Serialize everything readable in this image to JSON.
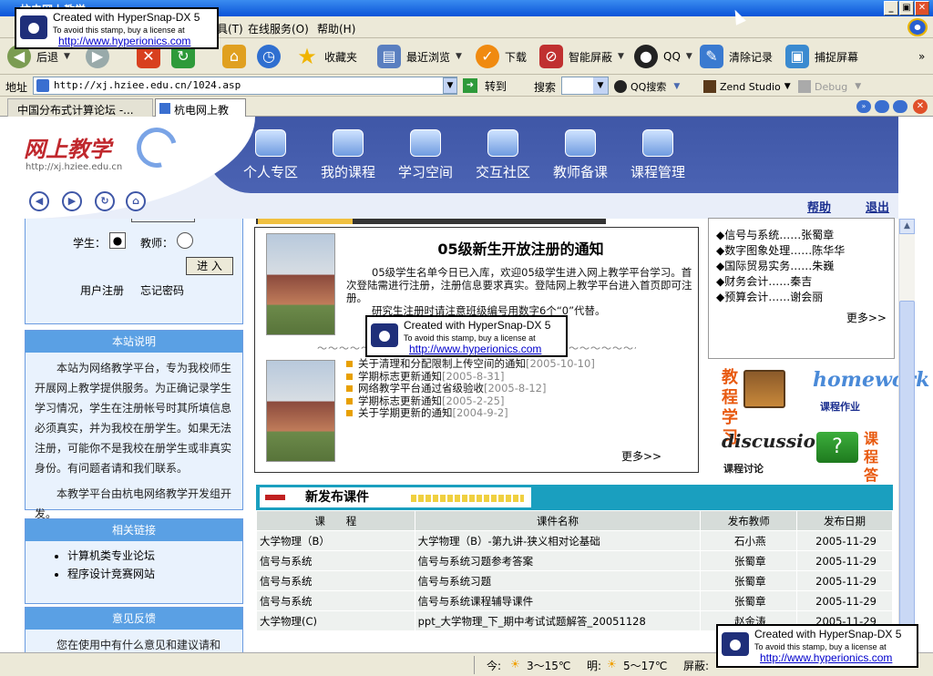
{
  "window": {
    "title": "杭电网上教学",
    "buttons": [
      "_",
      "▣",
      "✕"
    ]
  },
  "menubar": {
    "items": [
      "具(T)",
      "在线服务(O)",
      "帮助(H)"
    ]
  },
  "toolbar": {
    "back_label": "后退",
    "favorites_label": "收藏夹",
    "recent_label": "最近浏览",
    "download_label": "下载",
    "block_label": "智能屏蔽",
    "qq_label": "QQ",
    "clear_label": "清除记录",
    "capture_label": "捕捉屏幕"
  },
  "addressbar": {
    "label": "地址",
    "url": "http://xj.hziee.edu.cn/1024.asp",
    "go_label": "转到",
    "search_label": "搜索",
    "qq_search_label": "QQ搜索",
    "zend_label": "Zend Studio",
    "debug_label": "Debug"
  },
  "tabs": [
    {
      "label": "中国分布式计算论坛 -..."
    },
    {
      "label": "杭电网上教学"
    }
  ],
  "site": {
    "logo_text": "网上教学",
    "logo_url": "http://xj.hziee.edu.cn",
    "nav": [
      "个人专区",
      "我的课程",
      "学习空间",
      "交互社区",
      "教师备课",
      "课程管理"
    ],
    "help_link": "帮助",
    "exit_link": "退出"
  },
  "login": {
    "student_label": "学生：",
    "teacher_label": "教师：",
    "enter_button": "进 入",
    "register_link": "用户注册",
    "forgot_link": "忘记密码"
  },
  "about": {
    "title": "本站说明",
    "para1": "本站为网络教学平台，专为我校师生开展网上教学提供服务。为正确记录学生学习情况，学生在注册帐号时其所填信息必须真实，并为我校在册学生。如果无法注册，可能你不是我校在册学生或非真实身份。有问题者请和我们联系。",
    "para2": "本教学平台由杭电网络教学开发组开发。"
  },
  "links": {
    "title": "相关链接",
    "items": [
      "计算机类专业论坛",
      "程序设计竞赛网站"
    ]
  },
  "feedback": {
    "title": "意见反馈",
    "text": "您在使用中有什么意见和建议请和"
  },
  "notice": {
    "title": "05级新生开放注册的通知",
    "body1": "05级学生名单今日已入库，欢迎05级学生进入网上教学平台学习。首次登陆需进行注册，注册信息要求真实。登陆网上教学平台进入首页即可注册。",
    "body2": "研究生注册时请注意班级编号用数字6个“0”代替。",
    "body3": "网络教学平台的问题，我们会尽快解决。",
    "items": [
      {
        "text": "关于清理和分配限制上传空间的通知",
        "date": "[2005-10-10]"
      },
      {
        "text": "学期标志更新通知",
        "date": "[2005-8-31]"
      },
      {
        "text": "网络教学平台通过省级验收",
        "date": "[2005-8-12]"
      },
      {
        "text": "学期标志更新通知",
        "date": "[2005-2-25]"
      },
      {
        "text": "关于学期更新的通知",
        "date": "[2004-9-2]"
      }
    ],
    "more": "更多>>"
  },
  "teachers": {
    "items": [
      "◆信号与系统……张蜀章",
      "◆数字图象处理……陈华华",
      "◆国际贸易实务……朱巍",
      "◆财务会计……秦吉",
      "◆预算会计……谢会丽"
    ],
    "more": "更多>>"
  },
  "decor": {
    "jiaoxue": "教程学习",
    "homework": "homework",
    "homework_sub": "课程作业",
    "discussion": "discussion",
    "discussion_sub": "课程讨论",
    "dayi": "课程答疑"
  },
  "courseware": {
    "title": "新发布课件",
    "headers": [
      "课　　程",
      "课件名称",
      "发布教师",
      "发布日期"
    ],
    "rows": [
      [
        "大学物理（B）",
        "大学物理（B）-第九讲-狭义相对论基础",
        "石小燕",
        "2005-11-29"
      ],
      [
        "信号与系统",
        "信号与系统习题参考答案",
        "张蜀章",
        "2005-11-29"
      ],
      [
        "信号与系统",
        "信号与系统习题",
        "张蜀章",
        "2005-11-29"
      ],
      [
        "信号与系统",
        "信号与系统课程辅导课件",
        "张蜀章",
        "2005-11-29"
      ],
      [
        "大学物理(C)",
        "ppt_大学物理_下_期中考试试题解答_20051128",
        "赵金涛",
        "2005-11-29"
      ]
    ]
  },
  "statusbar": {
    "today": "今:",
    "today_temp": "3～15℃",
    "tomorrow": "明:",
    "tomorrow_temp": "5～17℃",
    "block": "屏蔽:"
  },
  "stamp": {
    "line1": "Created with HyperSnap-DX 5",
    "line2": "To avoid this stamp, buy a license at",
    "line3": "http://www.hyperionics.com"
  }
}
